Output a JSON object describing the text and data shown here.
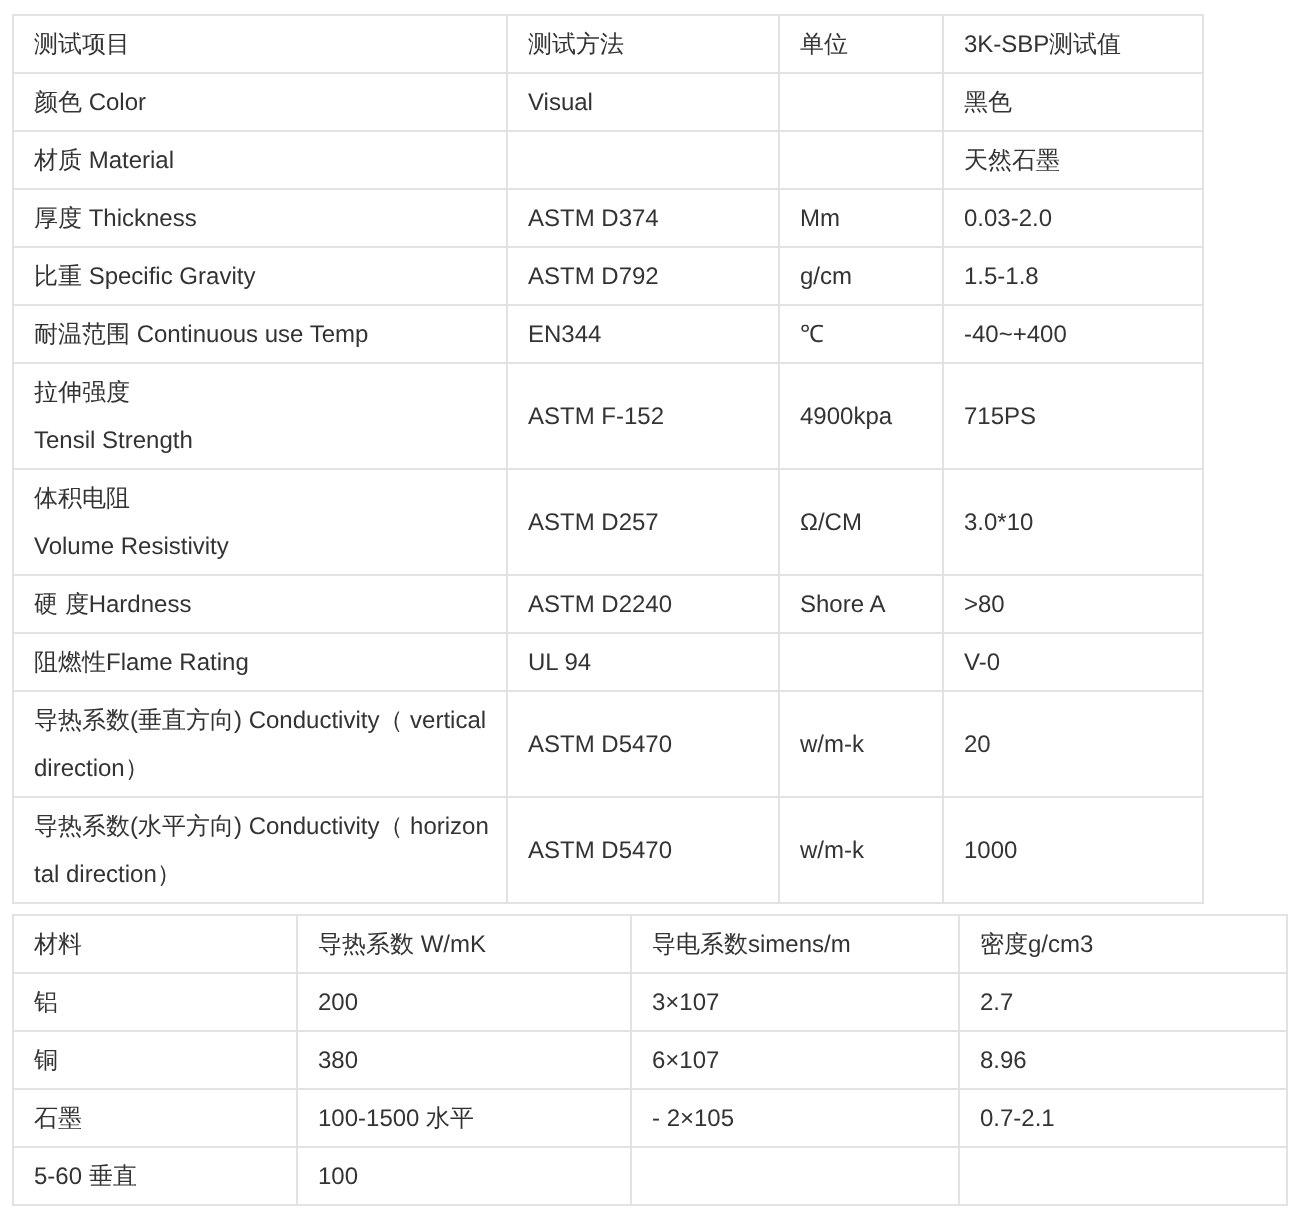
{
  "spec_table": {
    "columns": [
      "测试项目",
      "测试方法",
      "单位",
      "3K-SBP测试值"
    ],
    "rows": [
      [
        [
          "颜色 Color"
        ],
        [
          "Visual"
        ],
        [],
        [
          "黑色"
        ]
      ],
      [
        [
          "材质 Material"
        ],
        [],
        [],
        [
          "天然石墨"
        ]
      ],
      [
        [
          "厚度 Thickness"
        ],
        [
          "ASTM D374"
        ],
        [
          "Mm"
        ],
        [
          "0.03-2.0"
        ]
      ],
      [
        [
          "比重 Specific Gravity"
        ],
        [
          "ASTM D792"
        ],
        [
          "g/cm"
        ],
        [
          "1.5-1.8"
        ]
      ],
      [
        [
          "耐温范围 Continuous use Temp"
        ],
        [
          "EN344"
        ],
        [
          "℃"
        ],
        [
          "-40~+400"
        ]
      ],
      [
        [
          "拉伸强度",
          "Tensil Strength"
        ],
        [
          "ASTM F-152"
        ],
        [
          "4900kpa"
        ],
        [
          "715PS"
        ]
      ],
      [
        [
          "体积电阻",
          "Volume Resistivity"
        ],
        [
          "ASTM D257"
        ],
        [
          "Ω/CM"
        ],
        [
          "3.0*10"
        ]
      ],
      [
        [
          "硬 度Hardness"
        ],
        [
          "ASTM D2240"
        ],
        [
          "Shore A"
        ],
        [
          ">80"
        ]
      ],
      [
        [
          "阻燃性Flame Rating"
        ],
        [
          "UL 94"
        ],
        [],
        [
          "V-0"
        ]
      ],
      [
        [
          "导热系数(垂直方向) Conductivity（ vertical",
          "direction）"
        ],
        [
          "ASTM D5470"
        ],
        [
          "w/m-k"
        ],
        [
          "20"
        ]
      ],
      [
        [
          "导热系数(水平方向) Conductivity（ horizon",
          "tal direction）"
        ],
        [
          "ASTM D5470"
        ],
        [
          "w/m-k"
        ],
        [
          "1000"
        ]
      ]
    ]
  },
  "material_table": {
    "columns": [
      "材料",
      "导热系数 W/mK",
      "导电系数simens/m",
      "密度g/cm3"
    ],
    "rows": [
      [
        [
          "铝"
        ],
        [
          "200"
        ],
        [
          "3×107"
        ],
        [
          "2.7"
        ]
      ],
      [
        [
          "铜"
        ],
        [
          "380"
        ],
        [
          "6×107"
        ],
        [
          "8.96"
        ]
      ],
      [
        [
          "石墨"
        ],
        [
          "100-1500 水平"
        ],
        [
          "- 2×105"
        ],
        [
          "0.7-2.1"
        ]
      ],
      [
        [
          "5-60 垂直"
        ],
        [
          "100"
        ],
        [],
        []
      ]
    ]
  }
}
